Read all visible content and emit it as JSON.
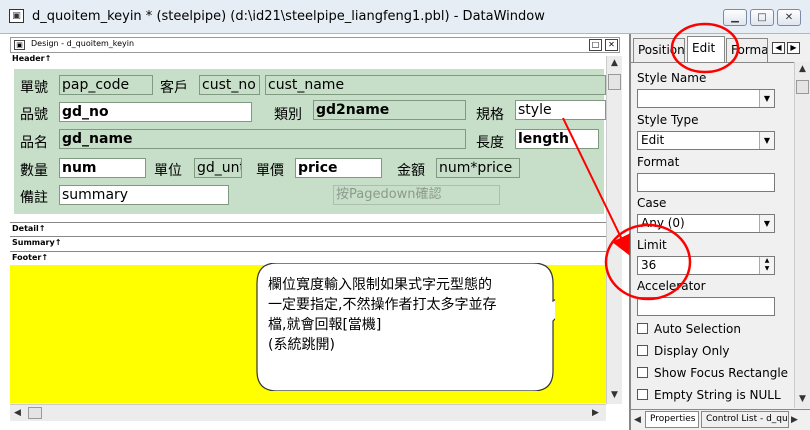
{
  "window": {
    "title": "d_quoitem_keyin * (steelpipe) (d:\\id21\\steelpipe_liangfeng1.pbl) - DataWindow",
    "minimize": "▁",
    "maximize": "□",
    "close": "✕"
  },
  "design": {
    "title": "Design - d_quoitem_keyin",
    "restore": "□",
    "close": "✕",
    "bands": {
      "header": "Header↑",
      "detail": "Detail↑",
      "summary": "Summary↑",
      "footer": "Footer↑"
    },
    "labels": {
      "order_no": "單號",
      "customer": "客戶",
      "product_no": "品號",
      "category": "類別",
      "spec": "規格",
      "product_name": "品名",
      "length": "長度",
      "qty": "數量",
      "unit": "單位",
      "price": "單價",
      "amount": "金額",
      "remark": "備註"
    },
    "fields": {
      "pap_code": "pap_code",
      "cust_no": "cust_no",
      "cust_name": "cust_name",
      "gd_no": "gd_no",
      "gd2name": "gd2name",
      "style": "style",
      "gd_name": "gd_name",
      "length": "length",
      "num": "num",
      "gd_unt": "gd_unt",
      "price": "price",
      "amount_expr": "num*price",
      "summary": "summary"
    },
    "hint": "按Pagedown確認"
  },
  "callout": {
    "lines": [
      "欄位寬度輸入限制如果式字元型態的",
      "一定要指定,不然操作者打太多字並存",
      "檔,就會回報[當機]",
      "(系統跳開)"
    ]
  },
  "properties": {
    "tabs": [
      "Position",
      "Edit",
      "Format"
    ],
    "active_tab": "Edit",
    "style_name_label": "Style Name",
    "style_name_value": "",
    "style_type_label": "Style Type",
    "style_type_value": "Edit",
    "format_label": "Format",
    "format_value": "",
    "case_label": "Case",
    "case_value": "Any (0)",
    "limit_label": "Limit",
    "limit_value": "36",
    "accelerator_label": "Accelerator",
    "accelerator_value": "",
    "checkboxes": [
      "Auto Selection",
      "Display Only",
      "Show Focus Rectangle",
      "Empty String is NULL"
    ],
    "bottom_tabs": [
      "Properties",
      "Control List - d_quo"
    ]
  },
  "colors": {
    "header_band": "#c7dfc8",
    "footer_band": "#ffff00",
    "annotation": "#ff0000"
  }
}
